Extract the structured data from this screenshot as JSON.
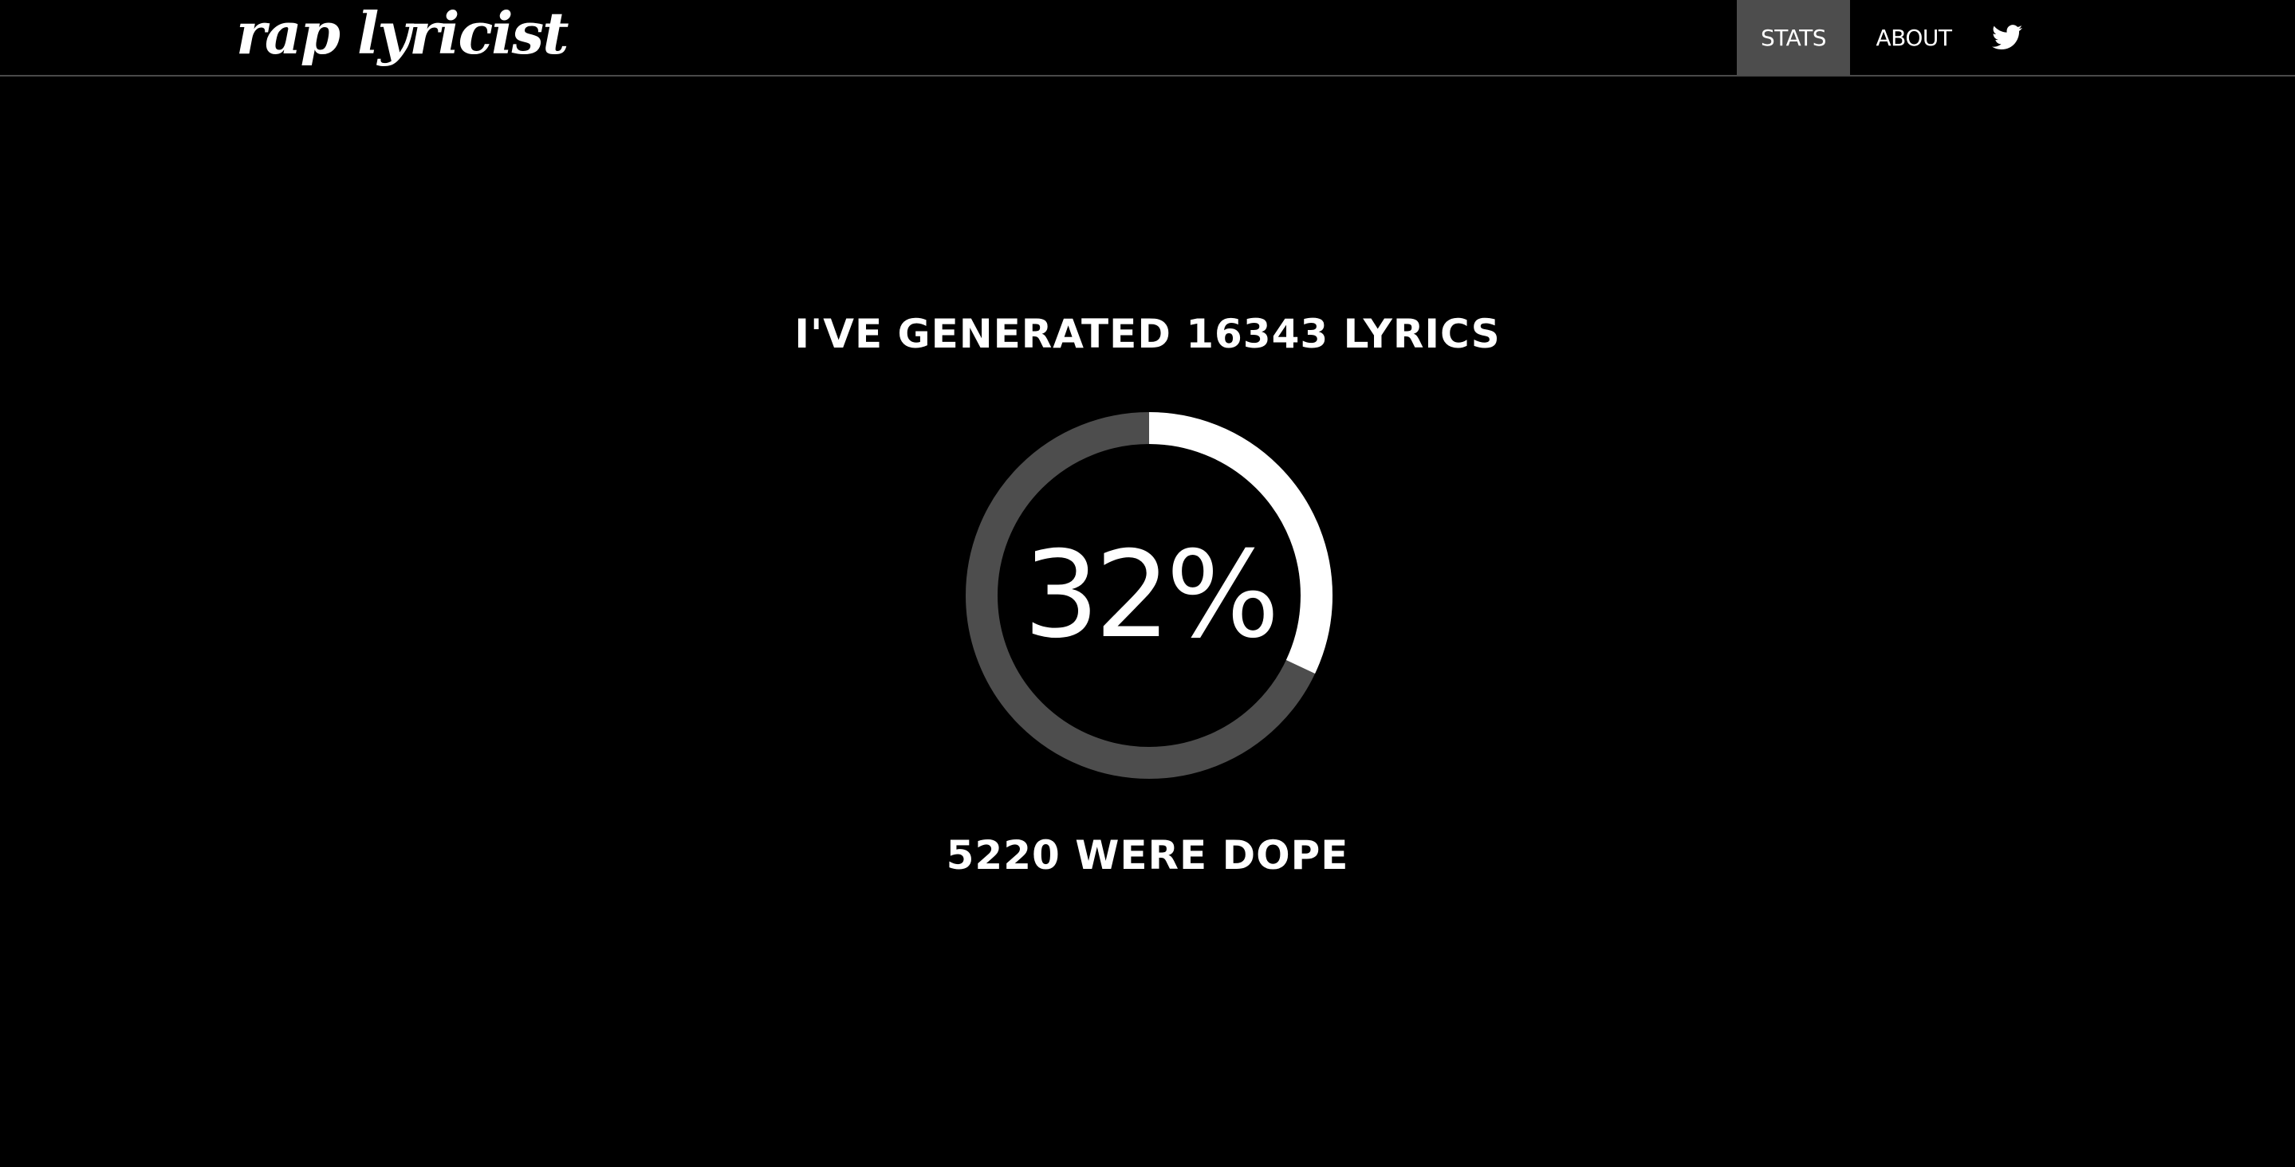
{
  "navbar": {
    "brand": "rap lyricist",
    "items": [
      {
        "label": "STATS",
        "active": true
      },
      {
        "label": "ABOUT",
        "active": false
      }
    ],
    "twitter_icon": "twitter-bird-icon"
  },
  "stats": {
    "headline": "I'VE GENERATED 16343 LYRICS",
    "percent_label": "32%",
    "progress_fraction": 0.32,
    "subline": "5220 WERE DOPE"
  },
  "colors": {
    "background": "#000000",
    "foreground": "#ffffff",
    "active_nav": "#4d4d4d",
    "ring_track": "#4d4d4d",
    "ring_fill": "#ffffff"
  }
}
